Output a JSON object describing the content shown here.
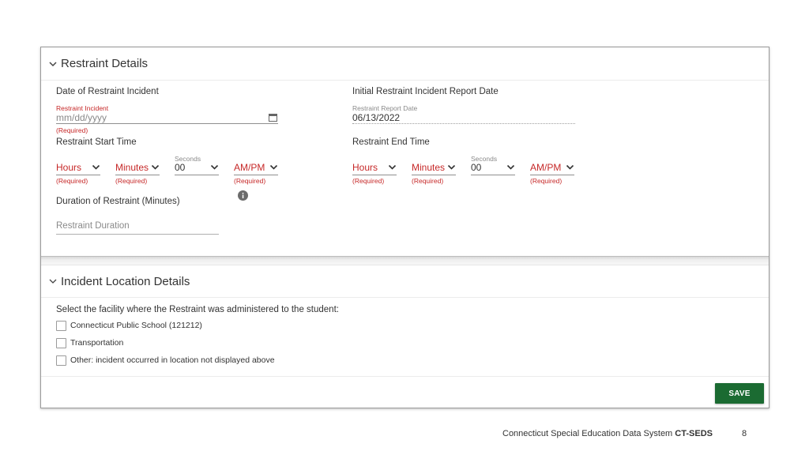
{
  "restraint": {
    "section_title": "Restraint Details",
    "date_heading": "Date of Restraint Incident",
    "date_label": "Restraint Incident",
    "date_placeholder": "mm/dd/yyyy",
    "required": "(Required)",
    "report_heading": "Initial Restraint Incident Report Date",
    "report_label": "Restraint Report Date",
    "report_value": "06/13/2022",
    "start_heading": "Restraint Start Time",
    "end_heading": "Restraint End Time",
    "hours": "Hours",
    "minutes": "Minutes",
    "seconds_label": "Seconds",
    "seconds_value": "00",
    "ampm": "AM/PM",
    "duration_heading": "Duration of Restraint (Minutes)",
    "duration_placeholder": "Restraint Duration"
  },
  "location": {
    "section_title": "Incident Location Details",
    "prompt": "Select the facility where the Restraint was administered to the student:",
    "options": [
      "Connecticut Public School (121212)",
      "Transportation",
      "Other: incident occurred in location not displayed above"
    ]
  },
  "actions": {
    "save": "SAVE"
  },
  "footer": {
    "system_name": "Connecticut Special Education Data System",
    "acronym": "CT-SEDS",
    "page_number": "8"
  },
  "colors": {
    "required_red": "#c62828",
    "save_green": "#1b6b32"
  }
}
